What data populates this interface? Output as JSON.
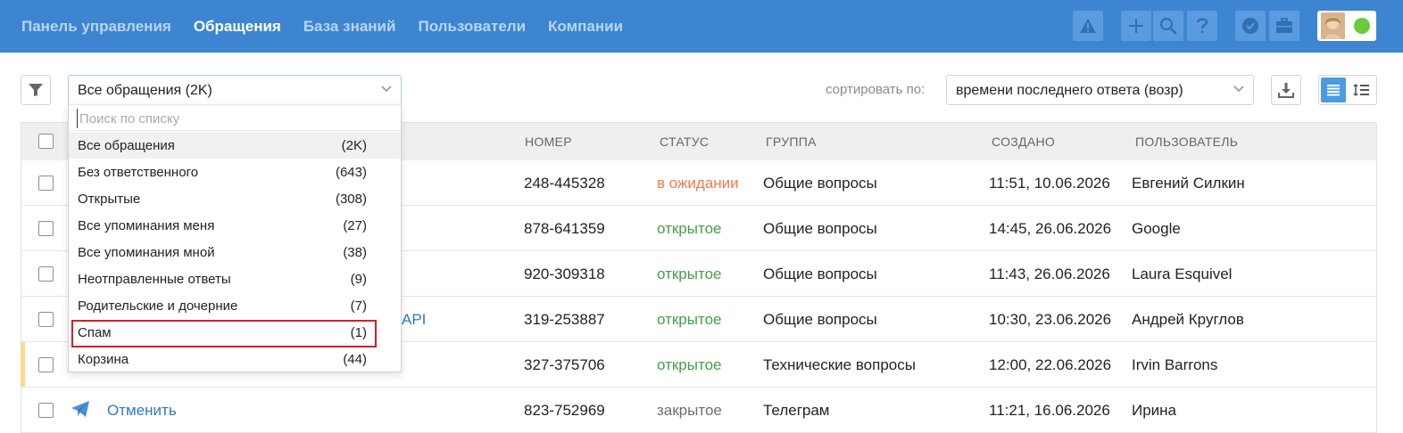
{
  "nav": {
    "items": [
      {
        "label": "Панель управления",
        "active": false
      },
      {
        "label": "Обращения",
        "active": true
      },
      {
        "label": "База знаний",
        "active": false
      },
      {
        "label": "Пользователи",
        "active": false
      },
      {
        "label": "Компании",
        "active": false
      }
    ],
    "icons": [
      "warning-icon",
      "plus-icon",
      "search-icon",
      "help-icon",
      "badge-check-icon",
      "briefcase-icon"
    ],
    "status_color": "#6acb3c"
  },
  "toolbar": {
    "filter_selected": "Все обращения (2K)",
    "sort_label": "сортировать по:",
    "sort_value": "времени последнего ответа (возр)"
  },
  "dropdown": {
    "search_placeholder": "Поиск по списку",
    "items": [
      {
        "label": "Все обращения",
        "count": "(2K)"
      },
      {
        "label": "Без ответственного",
        "count": "(643)"
      },
      {
        "label": "Открытые",
        "count": "(308)"
      },
      {
        "label": "Все упоминания меня",
        "count": "(27)"
      },
      {
        "label": "Все упоминания мной",
        "count": "(38)"
      },
      {
        "label": "Неотправленные ответы",
        "count": "(9)"
      },
      {
        "label": "Родительские и дочерние",
        "count": "(7)"
      },
      {
        "label": "Спам",
        "count": "(1)"
      },
      {
        "label": "Корзина",
        "count": "(44)"
      }
    ]
  },
  "table": {
    "headers": {
      "number": "НОМЕР",
      "status": "СТАТУС",
      "group": "ГРУППА",
      "created": "СОЗДАНО",
      "user": "ПОЛЬЗОВАТЕЛЬ"
    },
    "rows": [
      {
        "subject": "",
        "number": "248-445328",
        "status": "в ожидании",
        "group": "Общие вопросы",
        "created": "11:51, 10.06.2026",
        "user": "Евгений Силкин"
      },
      {
        "subject": "",
        "number": "878-641359",
        "status": "открытое",
        "group": "Общие вопросы",
        "created": "14:45, 26.06.2026",
        "user": "Google"
      },
      {
        "subject": "",
        "number": "920-309318",
        "status": "открытое",
        "group": "Общие вопросы",
        "created": "11:43, 26.06.2026",
        "user": "Laura Esquivel"
      },
      {
        "subject": "API",
        "number": "319-253887",
        "status": "открытое",
        "group": "Общие вопросы",
        "created": "10:30, 23.06.2026",
        "user": "Андрей Круглов"
      },
      {
        "subject": "",
        "number": "327-375706",
        "status": "открытое",
        "group": "Технические вопросы",
        "created": "12:00, 22.06.2026",
        "user": "Irvin Barrons"
      },
      {
        "subject": "Отменить",
        "number": "823-752969",
        "status": "закрытое",
        "group": "Телеграм",
        "created": "11:21, 16.06.2026",
        "user": "Ирина"
      }
    ]
  },
  "colors": {
    "topbar": "#3d85d1",
    "status_waiting": "#f07a4e",
    "status_open": "#44a04a",
    "status_closed": "#6d6d6d",
    "link": "#2f79c2",
    "highlight_box": "#d0202d"
  }
}
